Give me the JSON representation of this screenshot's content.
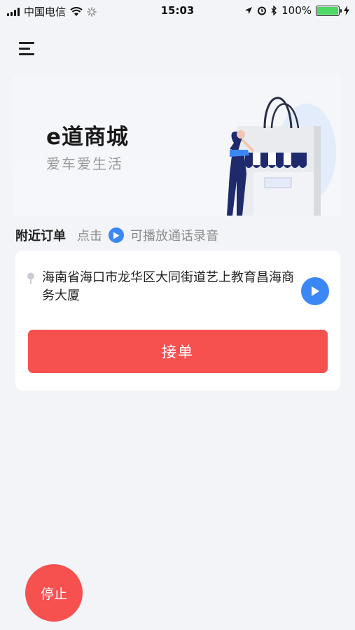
{
  "status_bar": {
    "carrier": "中国电信",
    "time": "15:03",
    "battery": "100%",
    "icons": [
      "signal-icon",
      "wifi-icon",
      "loading-icon",
      "location-icon",
      "alarm-icon",
      "bluetooth-icon",
      "battery-icon",
      "charging-icon"
    ]
  },
  "banner": {
    "title": "e道商城",
    "subtitle": "爱车爱生活"
  },
  "orders": {
    "title": "附近订单",
    "hint_prefix": "点击",
    "hint_suffix": "可播放通话录音"
  },
  "order_card": {
    "address": "海南省海口市龙华区大同街道艺上教育昌海商务大厦",
    "accept_label": "接单"
  },
  "stop_label": "停止",
  "colors": {
    "accent_red": "#f6504f",
    "accent_blue": "#3a87f5",
    "background": "#f2f4f7"
  }
}
